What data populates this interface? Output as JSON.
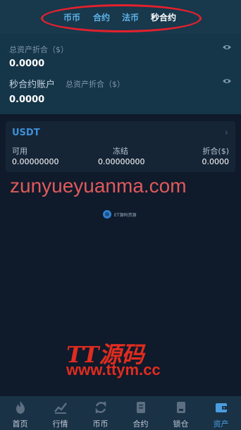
{
  "tabs": [
    {
      "label": "币币"
    },
    {
      "label": "合约"
    },
    {
      "label": "法币"
    },
    {
      "label": "秒合约",
      "active": true
    }
  ],
  "summary": {
    "total_label": "总资产折合（$）",
    "total_value": "0.0000",
    "account_title": "秒合约账户",
    "account_total_label": "总资产折合（$）",
    "account_value": "0.0000"
  },
  "asset_card": {
    "coin": "USDT",
    "available_label": "可用",
    "frozen_label": "冻结",
    "converted_label": "折合($)",
    "available_value": "0.00000000",
    "frozen_value": "0.00000000",
    "converted_value": "0.0000"
  },
  "watermarks": {
    "site_url": "zunyueyuanma.com",
    "small_text": "ET源码资源",
    "brand": "TT源码",
    "brand_url": "www.ttym.cc"
  },
  "bottom_nav": [
    {
      "label": "首页",
      "icon": "fire-icon"
    },
    {
      "label": "行情",
      "icon": "chart-icon"
    },
    {
      "label": "币币",
      "icon": "exchange-icon"
    },
    {
      "label": "合约",
      "icon": "contract-icon"
    },
    {
      "label": "锁仓",
      "icon": "lock-icon"
    },
    {
      "label": "资产",
      "icon": "wallet-icon",
      "active": true
    }
  ],
  "colors": {
    "accent": "#4a9ee0",
    "highlight_ellipse": "#e5212c",
    "watermark_red": "#e02c1f"
  }
}
